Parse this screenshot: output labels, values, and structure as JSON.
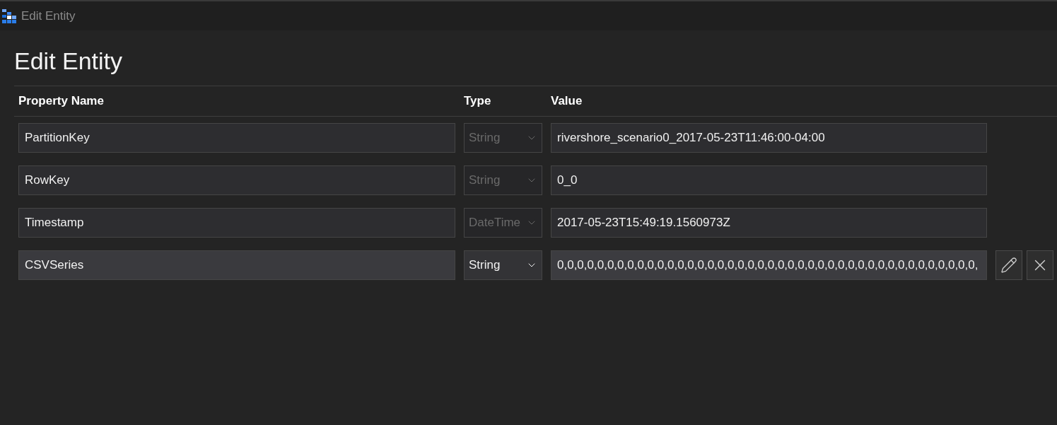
{
  "window": {
    "title": "Edit Entity"
  },
  "heading": "Edit Entity",
  "table": {
    "columns": [
      "Property Name",
      "Type",
      "Value"
    ],
    "rows": [
      {
        "name": "PartitionKey",
        "type": "String",
        "value": "rivershore_scenario0_2017-05-23T11:46:00-04:00",
        "disabled": true
      },
      {
        "name": "RowKey",
        "type": "String",
        "value": "0_0",
        "disabled": true
      },
      {
        "name": "Timestamp",
        "type": "DateTime",
        "value": "2017-05-23T15:49:19.1560973Z",
        "disabled": true
      },
      {
        "name": "CSVSeries",
        "type": "String",
        "value": "0,0,0,0,0,0,0,0,0,0,0,0,0,0,0,0,0,0,0,0,0,0,0,0,0,0,0,0,0,0,0,0,0,0,0,0,0,0,0,0,0,0,",
        "disabled": false
      }
    ]
  }
}
